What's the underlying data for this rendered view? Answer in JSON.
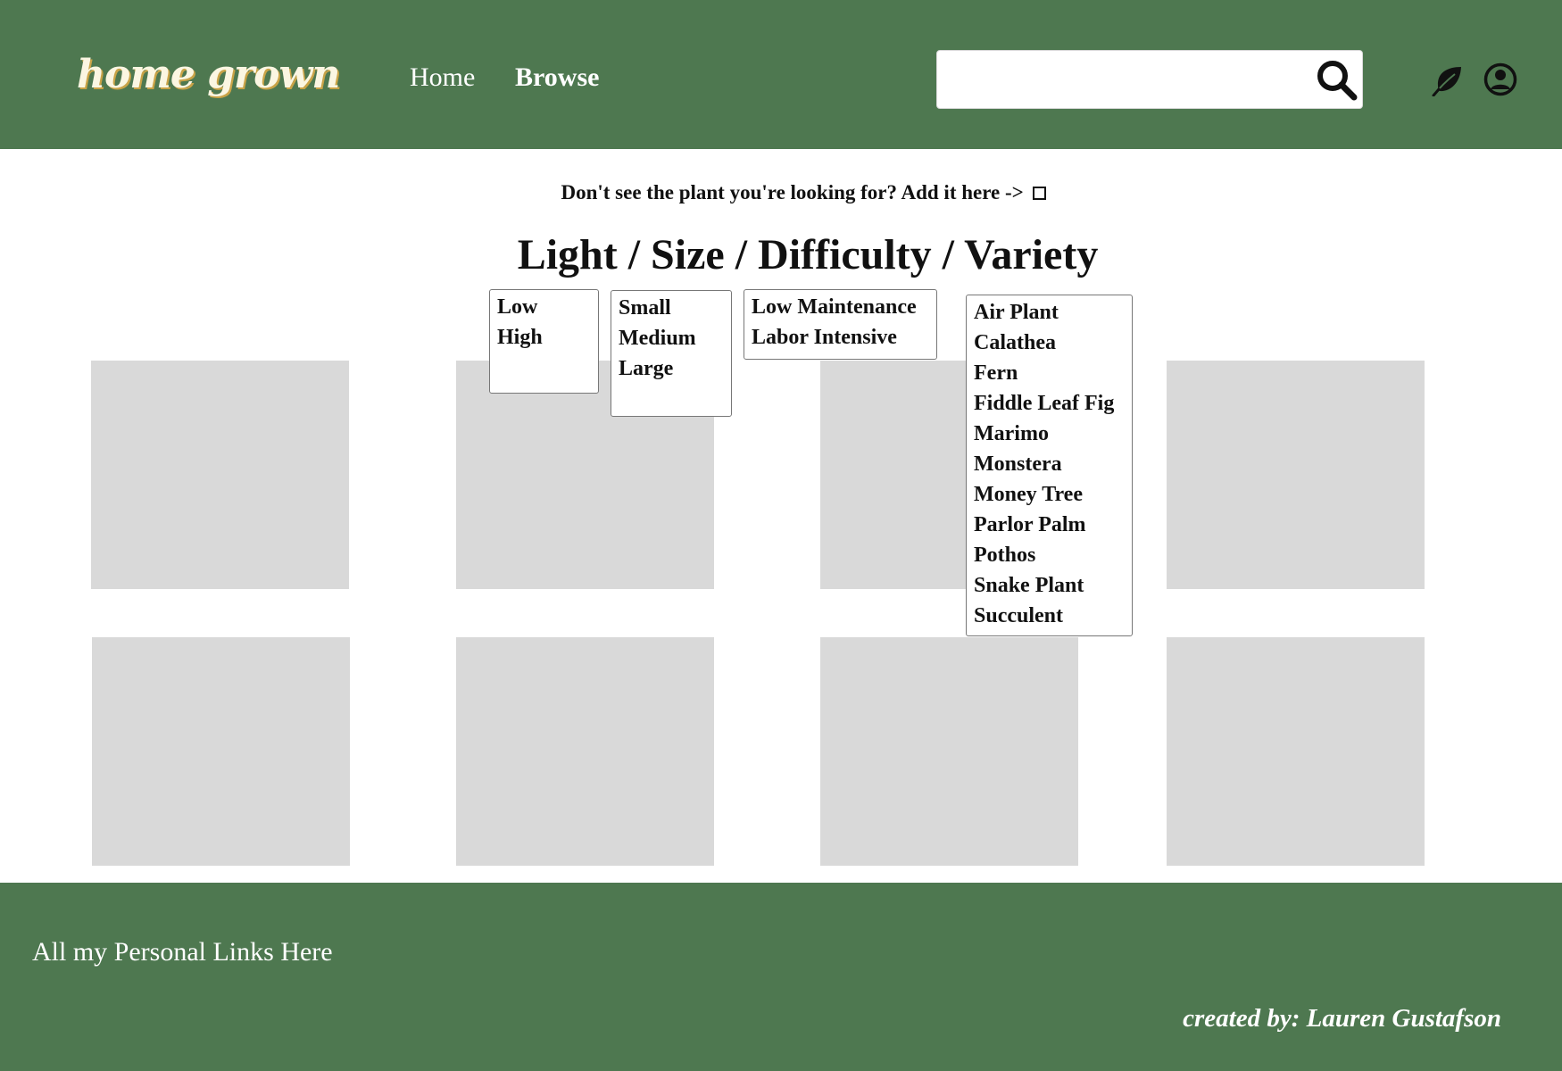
{
  "header": {
    "logo": "home grown",
    "nav": {
      "home": "Home",
      "browse": "Browse"
    },
    "search": {
      "value": "",
      "placeholder": ""
    },
    "icons": [
      "search-icon",
      "leaf-icon",
      "user-icon"
    ]
  },
  "main": {
    "add_prompt": "Don't see the plant you're looking for? Add it here ->",
    "filter_title": "Light / Size / Difficulty / Variety",
    "filters": {
      "light": [
        "Low",
        "High"
      ],
      "size": [
        "Small",
        "Medium",
        "Large"
      ],
      "difficulty": [
        "Low Maintenance",
        "Labor Intensive"
      ],
      "variety": [
        "Air Plant",
        "Calathea",
        "Fern",
        "Fiddle Leaf Fig",
        "Marimo",
        "Monstera",
        "Money Tree",
        "Parlor Palm",
        "Pothos",
        "Snake Plant",
        "Succulent"
      ]
    },
    "card_count": 8
  },
  "footer": {
    "links": "All my Personal Links Here",
    "credit": "created by: Lauren Gustafson"
  },
  "colors": {
    "brand_green": "#4e7850",
    "card_gray": "#d9d9d9",
    "logo_cream": "#fbf6e2",
    "logo_gold": "#c9a347"
  }
}
